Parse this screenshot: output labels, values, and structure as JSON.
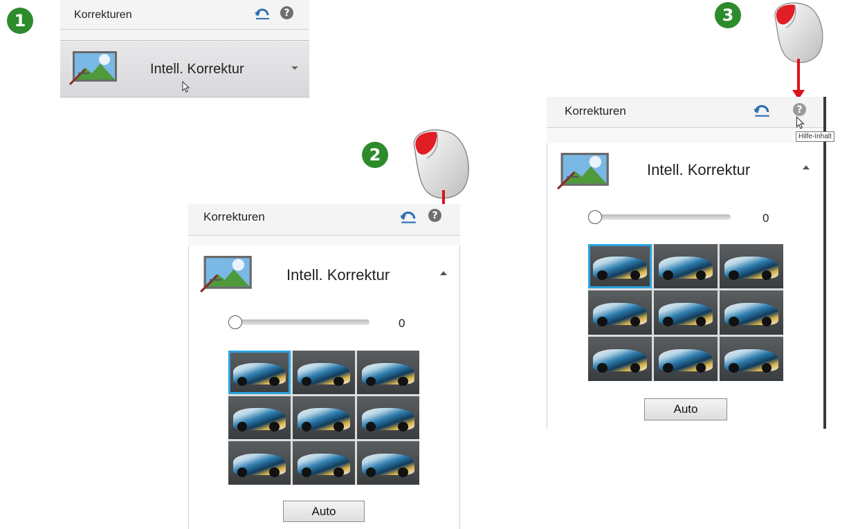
{
  "callouts": [
    "1",
    "2",
    "3"
  ],
  "panels": [
    {
      "title": "Korrekturen",
      "help": "?",
      "section": "Intell. Korrektur"
    },
    {
      "title": "Korrekturen",
      "help": "?",
      "section": "Intell. Korrektur",
      "slider_value": "0",
      "button": "Auto"
    },
    {
      "title": "Korrekturen",
      "help": "?",
      "section": "Intell. Korrektur",
      "slider_value": "0",
      "button": "Auto",
      "tooltip": "Hilfe-Inhalt"
    }
  ],
  "icons": {
    "reset": "reset-arrow-icon",
    "help": "help-icon",
    "expand": "triangle-icon",
    "mouse": "mouse-icon",
    "section": "smart-fix-icon"
  },
  "colors": {
    "badge": "#2e8b2b",
    "arrow": "#d9141b",
    "selection": "#2aa3e0"
  }
}
